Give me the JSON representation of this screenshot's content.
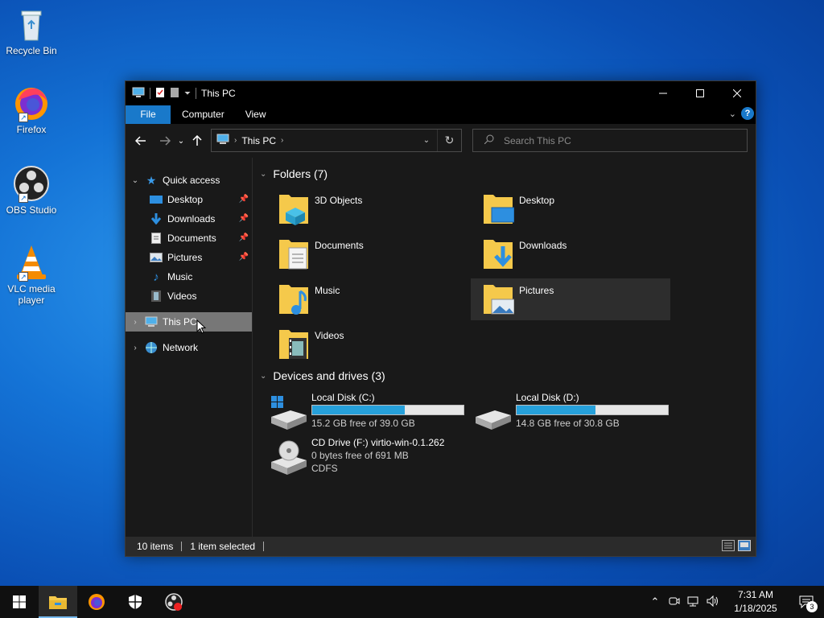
{
  "desktop": {
    "icons": [
      {
        "label": "Recycle Bin",
        "icon": "recycle-bin-icon"
      },
      {
        "label": "Firefox",
        "icon": "firefox-icon"
      },
      {
        "label": "OBS Studio",
        "icon": "obs-icon"
      },
      {
        "label": "VLC media player",
        "icon": "vlc-icon"
      }
    ]
  },
  "window": {
    "title": "This PC",
    "ribbon_tabs": [
      "File",
      "Computer",
      "View"
    ],
    "address_path": "This PC",
    "search_placeholder": "Search This PC"
  },
  "sidebar": {
    "quick_access": "Quick access",
    "items": [
      {
        "label": "Desktop",
        "pinned": true
      },
      {
        "label": "Downloads",
        "pinned": true
      },
      {
        "label": "Documents",
        "pinned": true
      },
      {
        "label": "Pictures",
        "pinned": true
      },
      {
        "label": "Music",
        "pinned": false
      },
      {
        "label": "Videos",
        "pinned": false
      }
    ],
    "this_pc": "This PC",
    "network": "Network"
  },
  "content": {
    "folders_header": "Folders (7)",
    "folders": [
      {
        "name": "3D Objects"
      },
      {
        "name": "Desktop"
      },
      {
        "name": "Documents"
      },
      {
        "name": "Downloads"
      },
      {
        "name": "Music"
      },
      {
        "name": "Pictures"
      },
      {
        "name": "Videos"
      }
    ],
    "drives_header": "Devices and drives (3)",
    "drives": [
      {
        "name": "Local Disk (C:)",
        "free": "15.2 GB free of 39.0 GB",
        "used_fraction": 0.61
      },
      {
        "name": "Local Disk (D:)",
        "free": "14.8 GB free of 30.8 GB",
        "used_fraction": 0.52
      },
      {
        "name": "CD Drive (F:) virtio-win-0.1.262",
        "free": "0 bytes free of 691 MB",
        "fs": "CDFS"
      }
    ]
  },
  "status": {
    "items_count": "10 items",
    "selected": "1 item selected"
  },
  "taskbar": {
    "time": "7:31 AM",
    "date": "1/18/2025",
    "notification_count": "3"
  },
  "colors": {
    "accent": "#1979ca",
    "drive_bar": "#26a0da"
  }
}
